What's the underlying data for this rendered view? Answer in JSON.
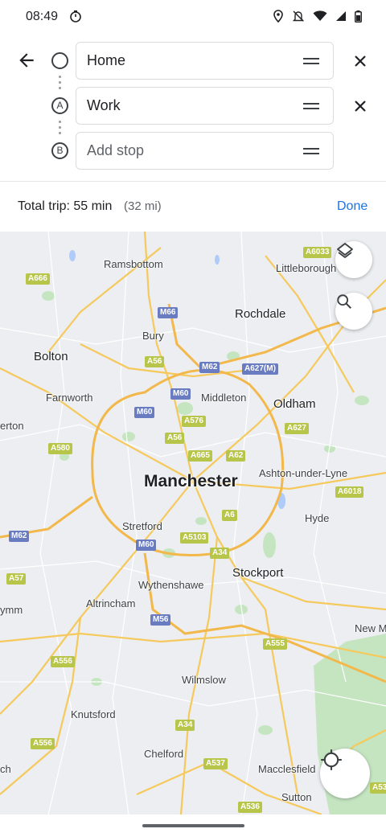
{
  "status_bar": {
    "time": "08:49"
  },
  "route": {
    "origin": "Home",
    "destination": "Work",
    "destination_marker": "A",
    "stop_marker": "B",
    "stop_placeholder": "Add stop"
  },
  "trip": {
    "total": "Total trip: 55 min",
    "distance": "(32 mi)",
    "done_label": "Done"
  },
  "map": {
    "places": [
      {
        "name": "Ramsbottom",
        "size": "small"
      },
      {
        "name": "Littleborough",
        "size": "small"
      },
      {
        "name": "Rochdale",
        "size": "medium"
      },
      {
        "name": "Bury",
        "size": "small"
      },
      {
        "name": "Bolton",
        "size": "medium"
      },
      {
        "name": "Farnworth",
        "size": "small"
      },
      {
        "name": "Middleton",
        "size": "small"
      },
      {
        "name": "Oldham",
        "size": "medium"
      },
      {
        "name": "erton",
        "size": "small"
      },
      {
        "name": "Manchester",
        "size": "big"
      },
      {
        "name": "Ashton-under-Lyne",
        "size": "small"
      },
      {
        "name": "Hyde",
        "size": "small"
      },
      {
        "name": "Stretford",
        "size": "small"
      },
      {
        "name": "Wythenshawe",
        "size": "small"
      },
      {
        "name": "Stockport",
        "size": "medium"
      },
      {
        "name": "Altrincham",
        "size": "small"
      },
      {
        "name": "ymm",
        "size": "small"
      },
      {
        "name": "New M",
        "size": "small"
      },
      {
        "name": "Wilmslow",
        "size": "small"
      },
      {
        "name": "Knutsford",
        "size": "small"
      },
      {
        "name": "Chelford",
        "size": "small"
      },
      {
        "name": "Macclesfield",
        "size": "small"
      },
      {
        "name": "ch",
        "size": "small"
      },
      {
        "name": "Sutton",
        "size": "small"
      }
    ],
    "road_shields": [
      {
        "ref": "A6033",
        "kind": "A"
      },
      {
        "ref": "A666",
        "kind": "A"
      },
      {
        "ref": "M66",
        "kind": "M"
      },
      {
        "ref": "A56",
        "kind": "A"
      },
      {
        "ref": "M62",
        "kind": "M"
      },
      {
        "ref": "A627(M)",
        "kind": "M"
      },
      {
        "ref": "M60",
        "kind": "M"
      },
      {
        "ref": "M60",
        "kind": "M"
      },
      {
        "ref": "A576",
        "kind": "A"
      },
      {
        "ref": "A627",
        "kind": "A"
      },
      {
        "ref": "A580",
        "kind": "A"
      },
      {
        "ref": "A56",
        "kind": "A"
      },
      {
        "ref": "A665",
        "kind": "A"
      },
      {
        "ref": "A62",
        "kind": "A"
      },
      {
        "ref": "A6018",
        "kind": "A"
      },
      {
        "ref": "A6",
        "kind": "A"
      },
      {
        "ref": "M62",
        "kind": "M"
      },
      {
        "ref": "A5103",
        "kind": "A"
      },
      {
        "ref": "M60",
        "kind": "M"
      },
      {
        "ref": "A34",
        "kind": "A"
      },
      {
        "ref": "A57",
        "kind": "A"
      },
      {
        "ref": "M56",
        "kind": "M"
      },
      {
        "ref": "A555",
        "kind": "A"
      },
      {
        "ref": "A556",
        "kind": "A"
      },
      {
        "ref": "A556",
        "kind": "A"
      },
      {
        "ref": "A34",
        "kind": "A"
      },
      {
        "ref": "A537",
        "kind": "A"
      },
      {
        "ref": "A536",
        "kind": "A"
      },
      {
        "ref": "A53",
        "kind": "A"
      }
    ]
  },
  "icons": {
    "back": "arrow-back-icon",
    "layers": "layers-icon",
    "search": "search-icon",
    "location": "my-location-icon"
  },
  "colors": {
    "accent": "#1a73e8",
    "a_road": "#b7c64a",
    "motorway": "#6a7cc1",
    "road": "#f5c95c",
    "park": "#c5e5c1"
  }
}
